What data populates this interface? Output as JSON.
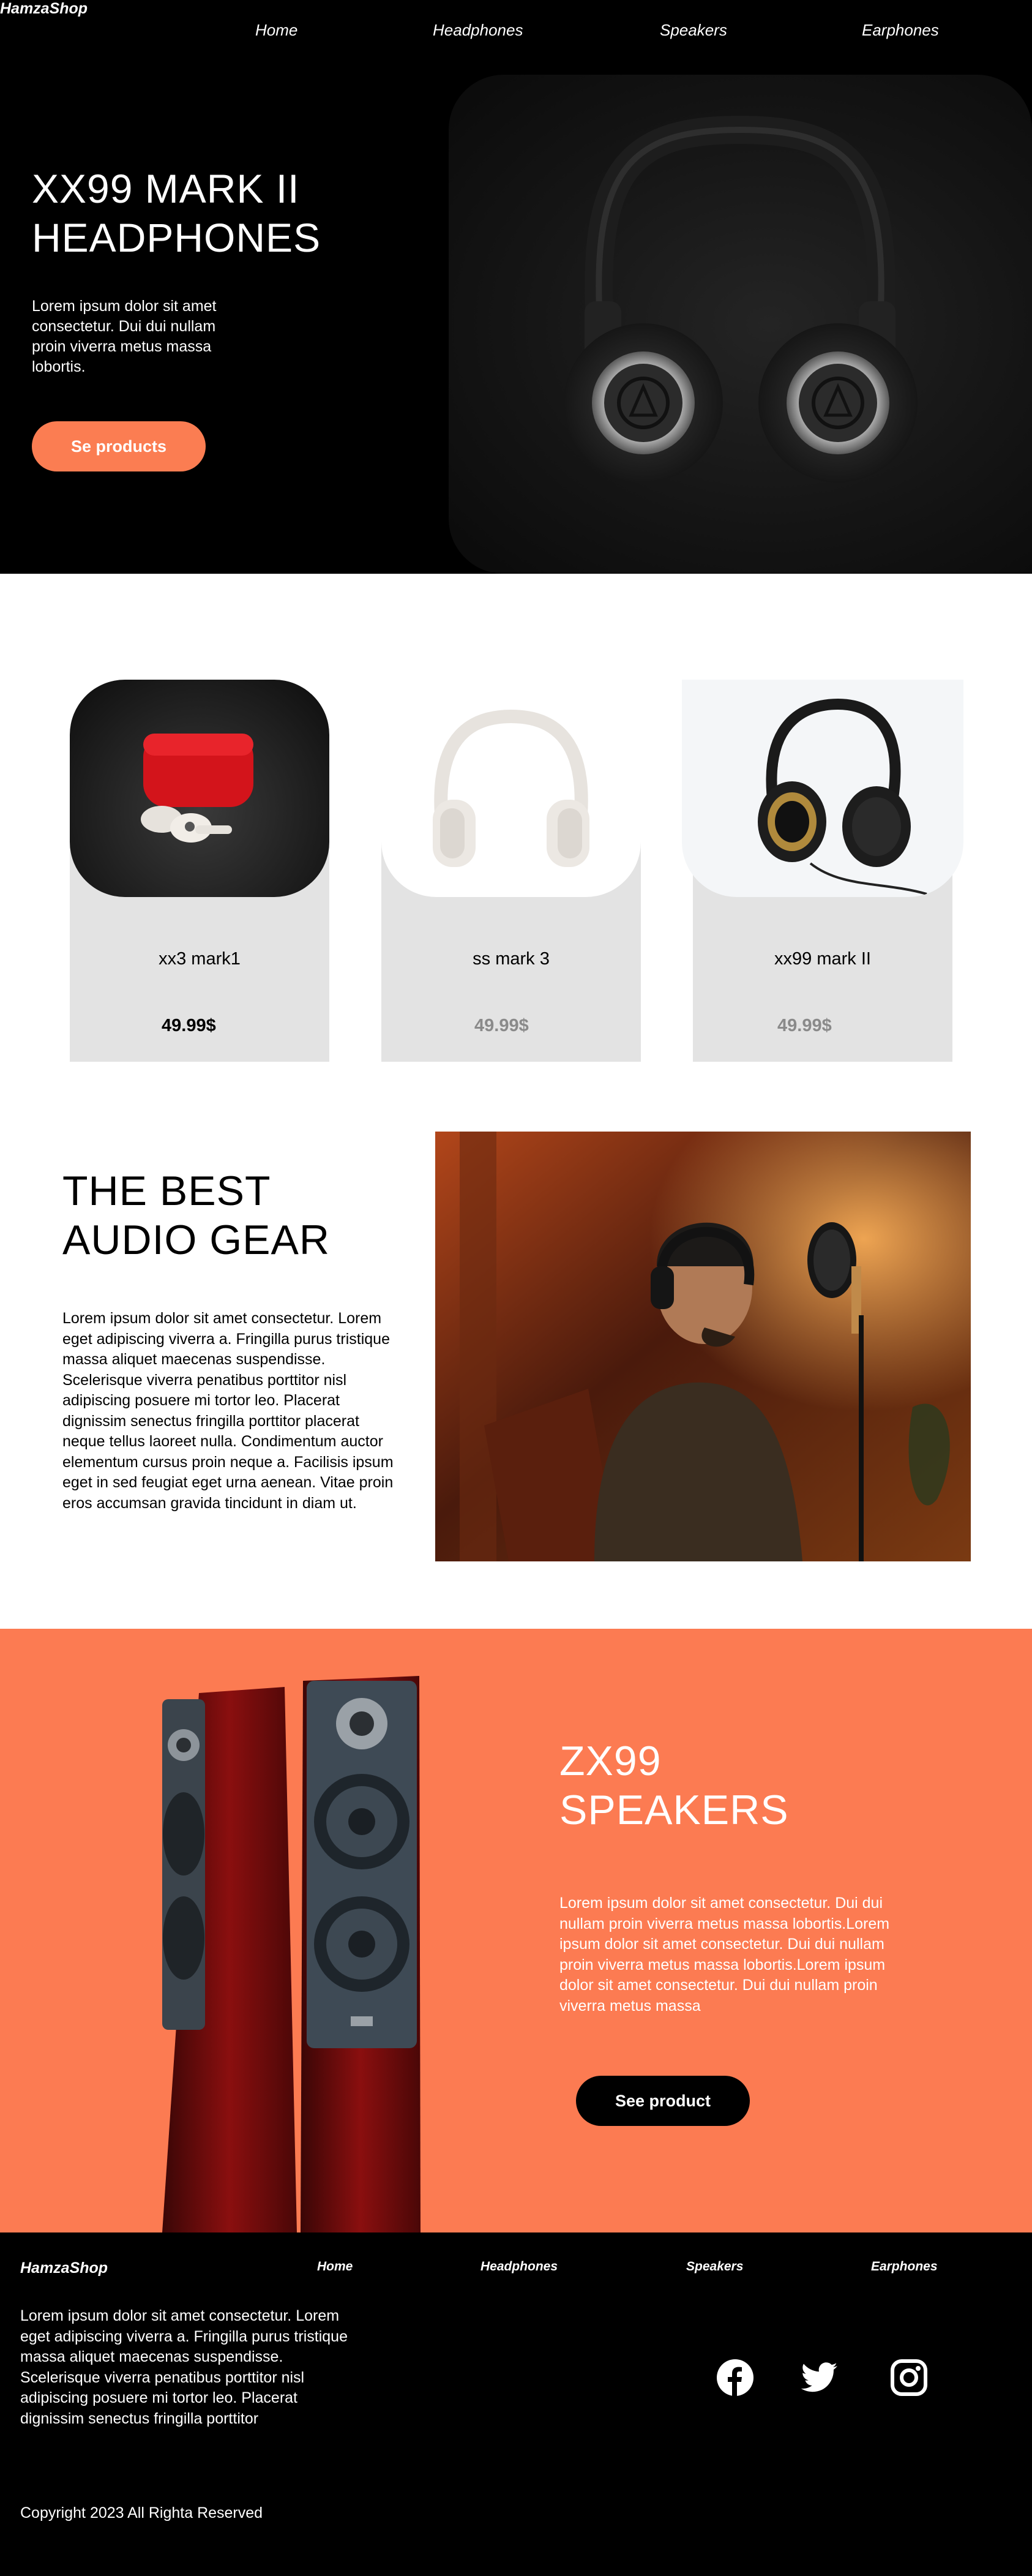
{
  "brand": "HamzaShop",
  "nav": [
    "Home",
    "Headphones",
    "Speakers",
    "Earphones"
  ],
  "hero": {
    "title_line1": "XX99 MARK II",
    "title_line2": "HEADPHONES",
    "text": "Lorem ipsum dolor sit amet consectetur. Dui dui nullam proin viverra metus massa lobortis.",
    "button": "Se products"
  },
  "products": [
    {
      "name": "xx3 mark1",
      "price": "49.99$"
    },
    {
      "name": "ss mark 3",
      "price": "49.99$"
    },
    {
      "name": "xx99 mark II",
      "price": "49.99$"
    }
  ],
  "audio": {
    "title_line1": "THE BEST",
    "title_line2": "AUDIO GEAR",
    "text": "Lorem ipsum dolor sit amet consectetur. Lorem eget adipiscing viverra a. Fringilla purus tristique massa aliquet maecenas suspendisse. Scelerisque viverra penatibus porttitor nisl adipiscing posuere mi tortor leo. Placerat dignissim senectus fringilla porttitor placerat neque tellus laoreet nulla. Condimentum auctor elementum cursus proin neque a. Facilisis ipsum eget in sed feugiat eget urna aenean. Vitae proin eros accumsan gravida tincidunt in diam ut."
  },
  "speakers": {
    "title_line1": "ZX99",
    "title_line2": "SPEAKERS",
    "text": "Lorem ipsum dolor sit amet consectetur. Dui dui nullam proin viverra metus massa lobortis.Lorem ipsum dolor sit amet consectetur. Dui dui nullam proin viverra metus massa lobortis.Lorem ipsum dolor sit amet consectetur. Dui dui nullam proin viverra metus massa",
    "button": "See product"
  },
  "footer": {
    "brand": "HamzaShop",
    "nav": [
      "Home",
      "Headphones",
      "Speakers",
      "Earphones"
    ],
    "text": "Lorem ipsum dolor sit amet consectetur. Lorem eget adipiscing viverra a. Fringilla purus tristique massa aliquet maecenas suspendisse. Scelerisque viverra penatibus porttitor nisl adipiscing posuere mi tortor leo. Placerat dignissim senectus fringilla porttitor",
    "social_icons": [
      "facebook-icon",
      "twitter-icon",
      "instagram-icon"
    ],
    "copyright": "Copyright 2023 All Righta Reserved"
  },
  "colors": {
    "accent": "#fc7b52",
    "background_dark": "#000000",
    "card_gray": "#e3e3e3",
    "price_muted": "#8a8a8a",
    "price_dark": "#000000"
  }
}
